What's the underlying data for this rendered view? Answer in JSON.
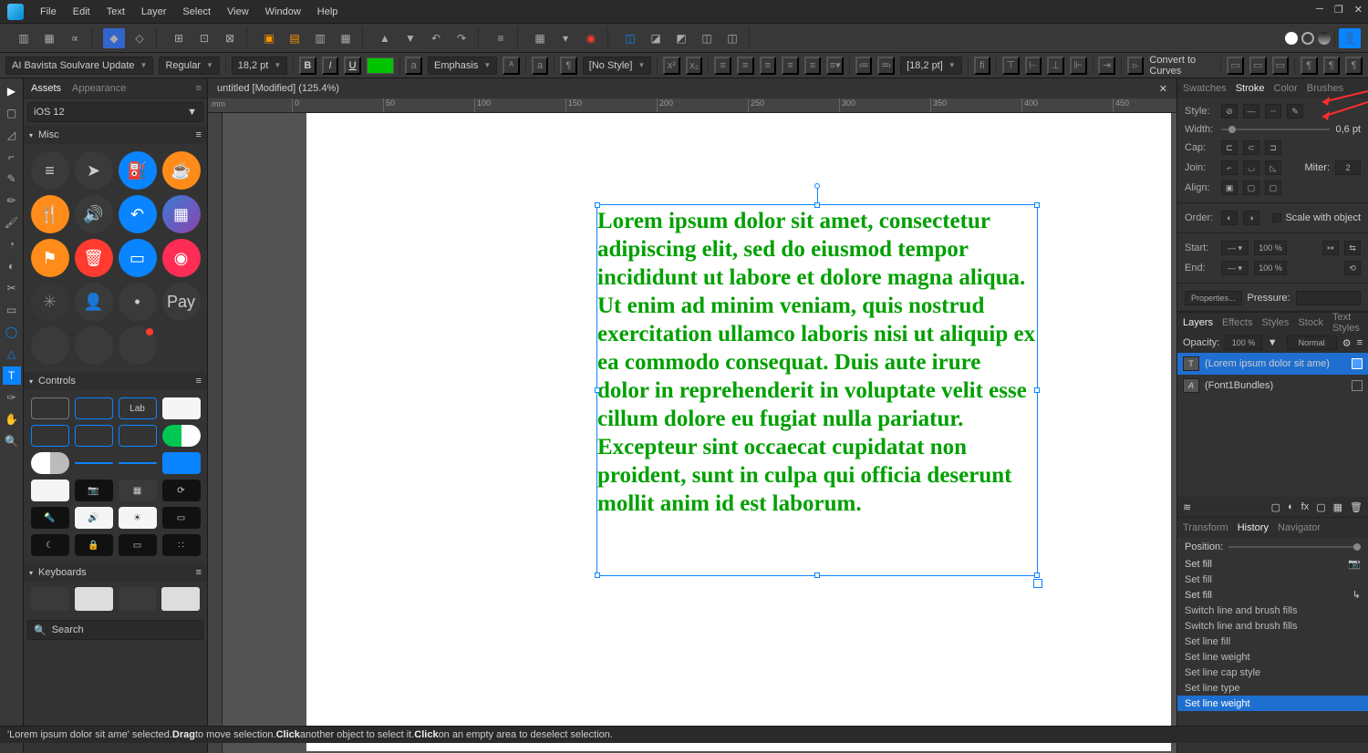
{
  "menubar": {
    "items": [
      "File",
      "Edit",
      "Text",
      "Layer",
      "Select",
      "View",
      "Window",
      "Help"
    ]
  },
  "document": {
    "tab_label": "untitled [Modified] (125.4%)",
    "ruler_unit": "mm"
  },
  "context_bar": {
    "font_family": "AI Bavista Soulvare Update",
    "font_style": "Regular",
    "font_size": "18,2 pt",
    "underline": "U",
    "char_style": "Emphasis",
    "para_style": "[No Style]",
    "leading": "[18,2 pt]",
    "convert": "Convert to Curves"
  },
  "left_panel": {
    "tabs": [
      "Assets",
      "Appearance"
    ],
    "library": "iOS 12",
    "sections": {
      "misc": "Misc",
      "controls": "Controls",
      "keyboards": "Keyboards"
    },
    "search_placeholder": "Search",
    "control_labels": {
      "lab": "Lab"
    }
  },
  "text_block": "Lorem ipsum dolor sit amet, consectetur adipiscing elit, sed do eiusmod tempor incididunt ut labore et dolore magna aliqua. Ut enim ad minim veniam, quis nostrud exercitation ullamco laboris nisi ut aliquip ex ea commodo consequat. Duis aute irure dolor in reprehenderit in voluptate velit esse cillum dolore eu fugiat nulla pariatur. Excepteur sint occaecat cupidatat non proident, sunt in culpa qui officia deserunt mollit anim id est laborum.",
  "right_panel": {
    "tabs_top": [
      "Swatches",
      "Stroke",
      "Color",
      "Brushes"
    ],
    "stroke": {
      "style_label": "Style:",
      "width_label": "Width:",
      "width_value": "0,6 pt",
      "cap_label": "Cap:",
      "join_label": "Join:",
      "miter_label": "Miter:",
      "miter_value": "2",
      "align_label": "Align:",
      "order_label": "Order:",
      "scale_label": "Scale with object",
      "start_label": "Start:",
      "start_pct": "100 %",
      "end_label": "End:",
      "end_pct": "100 %",
      "properties": "Properties...",
      "pressure": "Pressure:"
    },
    "tabs_layers": [
      "Layers",
      "Effects",
      "Styles",
      "Stock",
      "Text Styles"
    ],
    "opacity_label": "Opacity:",
    "opacity_value": "100 %",
    "blend_mode": "Normal",
    "layers": [
      {
        "name": "(Lorem ipsum dolor sit ame)",
        "selected": true
      },
      {
        "name": "(Font1Bundles)",
        "selected": false
      }
    ],
    "tabs_history": [
      "Transform",
      "History",
      "Navigator"
    ],
    "history_position": "Position:",
    "history": [
      "Set fill",
      "Set fill",
      "Set fill",
      "Switch line and brush fills",
      "Switch line and brush fills",
      "Set line fill",
      "Set line weight",
      "Set line cap style",
      "Set line type",
      "Set line weight"
    ]
  },
  "status_bar": {
    "text_pre": "'Lorem ipsum dolor sit ame' selected. ",
    "drag": "Drag",
    "drag_post": " to move selection. ",
    "click1": "Click",
    "click1_post": " another object to select it. ",
    "click2": "Click",
    "click2_post": " on an empty area to deselect selection."
  },
  "colors": {
    "fill": "#00c400",
    "text": "#00a000",
    "selection": "#0a84ff"
  }
}
